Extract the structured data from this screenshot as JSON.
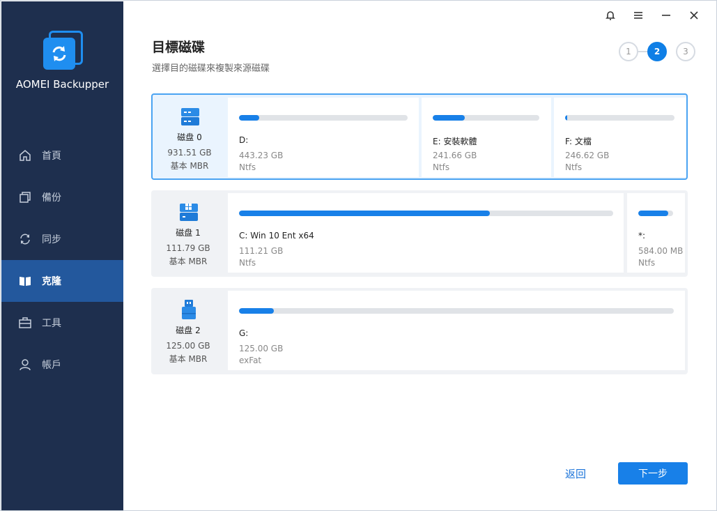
{
  "app": {
    "name": "AOMEI Backupper"
  },
  "sidebar": {
    "items": [
      {
        "label": "首頁",
        "icon": "home-icon",
        "active": false
      },
      {
        "label": "備份",
        "icon": "backup-icon",
        "active": false
      },
      {
        "label": "同步",
        "icon": "sync-icon",
        "active": false
      },
      {
        "label": "克隆",
        "icon": "clone-icon",
        "active": true
      },
      {
        "label": "工具",
        "icon": "toolbox-icon",
        "active": false
      },
      {
        "label": "帳戶",
        "icon": "user-icon",
        "active": false
      }
    ]
  },
  "header": {
    "title": "目標磁碟",
    "subtitle": "選擇目的磁碟來複製來源磁碟"
  },
  "steps": {
    "items": [
      "1",
      "2",
      "3"
    ],
    "current": 2
  },
  "disks": [
    {
      "name": "磁盘 0",
      "size": "931.51 GB",
      "type": "基本 MBR",
      "icon": "hard-disk-icon",
      "selected": true,
      "partitions": [
        {
          "label": "D:",
          "size": "443.23 GB",
          "fs": "Ntfs",
          "used": 0.12
        },
        {
          "label": "E: 安裝軟體",
          "size": "241.66 GB",
          "fs": "Ntfs",
          "used": 0.3
        },
        {
          "label": "F: 文檔",
          "size": "246.62 GB",
          "fs": "Ntfs",
          "used": 0.02
        }
      ]
    },
    {
      "name": "磁盘 1",
      "size": "111.79 GB",
      "type": "基本 MBR",
      "icon": "windows-disk-icon",
      "selected": false,
      "partitions": [
        {
          "label": "C: Win 10 Ent x64",
          "size": "111.21 GB",
          "fs": "Ntfs",
          "used": 0.67
        },
        {
          "label": "*:",
          "size": "584.00 MB",
          "fs": "Ntfs",
          "used": 0.85
        }
      ]
    },
    {
      "name": "磁盘 2",
      "size": "125.00 GB",
      "type": "基本 MBR",
      "icon": "usb-drive-icon",
      "selected": false,
      "partitions": [
        {
          "label": "G:",
          "size": "125.00 GB",
          "fs": "exFat",
          "used": 0.08
        }
      ]
    }
  ],
  "footer": {
    "back_label": "返回",
    "next_label": "下一步"
  },
  "colors": {
    "sidebar_bg": "#1e2f4e",
    "sidebar_active": "#23589d",
    "accent": "#1880e8"
  }
}
